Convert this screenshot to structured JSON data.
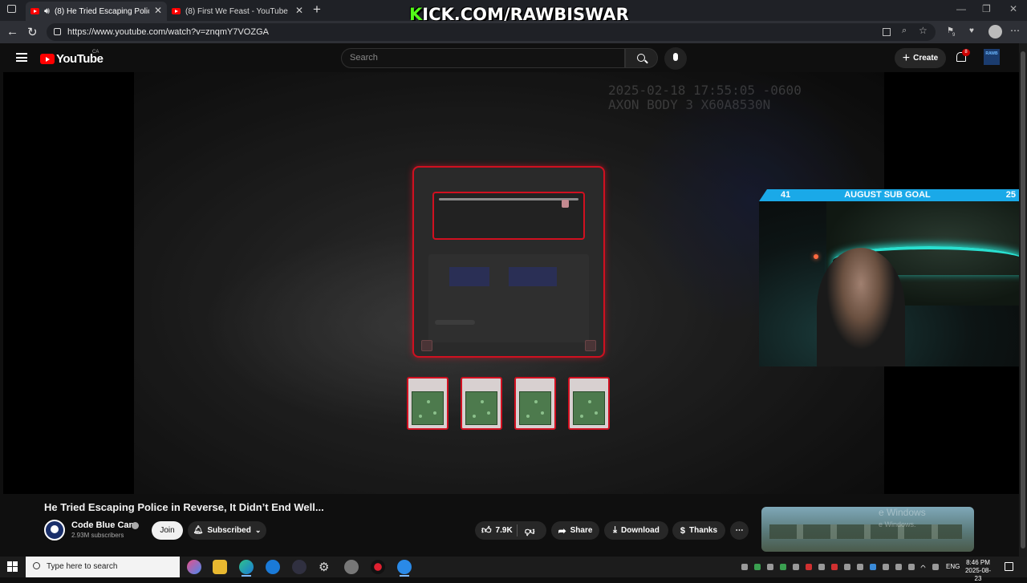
{
  "browser": {
    "tabs": [
      {
        "title": "(8) He Tried Escaping Police i",
        "active": true,
        "playing_audio": true
      },
      {
        "title": "(8) First We Feast - YouTube",
        "active": false
      }
    ],
    "new_tab_label": "+",
    "url": "https://www.youtube.com/watch?v=znqmY7VOZGA",
    "extension_badge": "9"
  },
  "stream_overlay": {
    "kick_prefix": "K",
    "kick_rest": "ICK.COM/RAWBISWAR",
    "sub_goal": {
      "current": "41",
      "label": "AUGUST SUB GOAL",
      "target": "25"
    }
  },
  "youtube": {
    "logo_text": "YouTube",
    "country_code": "CA",
    "search_placeholder": "Search",
    "create_label": "Create",
    "notification_count": "8",
    "avatar_text": "RAWB"
  },
  "video": {
    "bodycam_stamp": "2025-02-18 17:55:05 -0600\nAXON BODY 3 X60A8530N",
    "captcha_slider_value": 0.93,
    "title": "He Tried Escaping Police in Reverse, It Didn’t End Well...",
    "channel": {
      "name": "Code Blue Cam",
      "subscribers": "2.93M subscribers",
      "verified": true
    },
    "join_label": "Join",
    "subscribed_label": "Subscribed",
    "likes": "7.9K",
    "share_label": "Share",
    "download_label": "Download",
    "thanks_label": "Thanks",
    "more_label": "⋯"
  },
  "watermark": {
    "line1": "e Windows",
    "line2": "e Windows."
  },
  "taskbar": {
    "search_placeholder": "Type here to search",
    "language": "ENG",
    "time": "8:46 PM",
    "date": "2025-08-23"
  },
  "colors": {
    "accent_red": "#d01020",
    "yt_red": "#ff0000",
    "kick_green": "#53fc18",
    "sub_goal_blue": "#1aa9e8"
  }
}
